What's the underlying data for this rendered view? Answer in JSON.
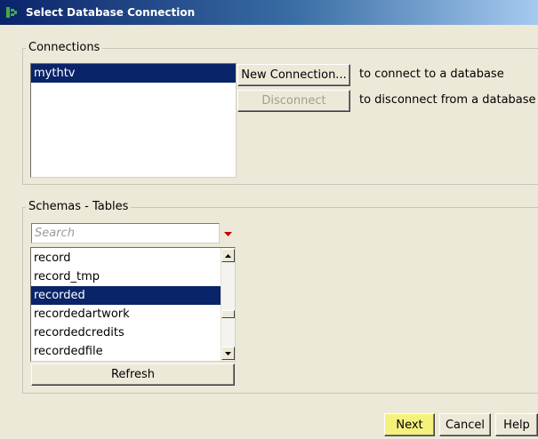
{
  "window": {
    "title": "Select Database Connection",
    "icon": "database-app-icon"
  },
  "connections": {
    "group_label": "Connections",
    "items": [
      {
        "label": "mythtv",
        "selected": true
      }
    ],
    "new_button": "New Connection...",
    "new_hint": "to connect to a database",
    "disconnect_button": "Disconnect",
    "disconnect_enabled": false,
    "disconnect_hint": "to disconnect from a database"
  },
  "schemas": {
    "group_label": "Schemas - Tables",
    "search_placeholder": "Search",
    "search_value": "",
    "items": [
      {
        "label": "record",
        "selected": false
      },
      {
        "label": "record_tmp",
        "selected": false
      },
      {
        "label": "recorded",
        "selected": true
      },
      {
        "label": "recordedartwork",
        "selected": false
      },
      {
        "label": "recordedcredits",
        "selected": false
      },
      {
        "label": "recordedfile",
        "selected": false
      }
    ],
    "refresh_button": "Refresh"
  },
  "footer": {
    "next_button": "Next",
    "cancel_button": "Cancel",
    "help_button": "Help"
  },
  "colors": {
    "selection": "#0a246a",
    "focus_highlight": "#f4f27c",
    "dropdown_arrow": "#cc0000"
  }
}
